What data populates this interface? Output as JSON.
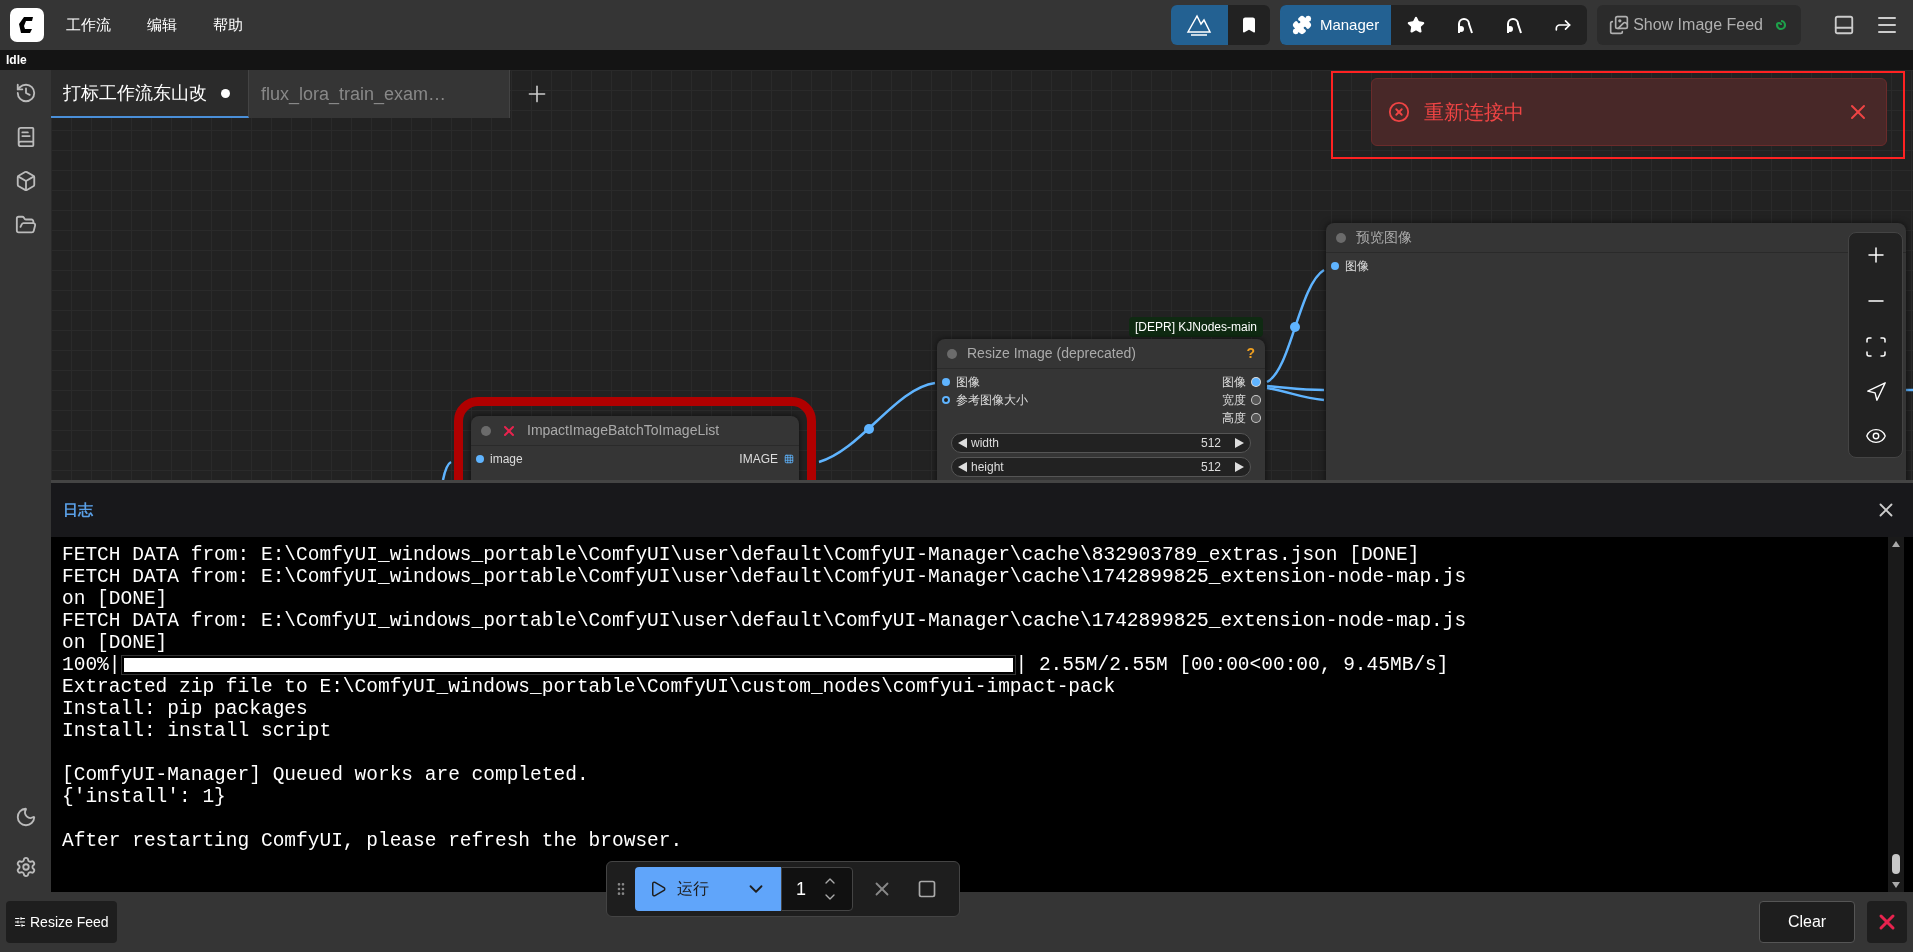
{
  "menu": [
    {
      "label": "工作流"
    },
    {
      "label": "编辑"
    },
    {
      "label": "帮助"
    }
  ],
  "status": "Idle",
  "toolbar": {
    "manager": "Manager",
    "image_feed": "Show Image Feed"
  },
  "tabs": [
    {
      "label": "打标工作流东山改",
      "selected": true,
      "modified": true
    },
    {
      "label": "flux_lora_train_exam…",
      "selected": false,
      "modified": false
    }
  ],
  "toast": {
    "message": "重新连接中"
  },
  "nodes": [
    {
      "title": "预览图像",
      "error": false,
      "inputs": [
        {
          "label": "图像",
          "optional": false
        }
      ]
    },
    {
      "title": "Resize Image (deprecated)",
      "badge": "[DEPR] KJNodes-main",
      "help": "?",
      "error": false,
      "inputs": [
        {
          "label": "图像",
          "optional": false
        },
        {
          "label": "参考图像大小",
          "optional": true
        }
      ],
      "outputs": [
        {
          "label": "图像",
          "connected": true,
          "list": false
        },
        {
          "label": "宽度",
          "connected": false,
          "list": false
        },
        {
          "label": "高度",
          "connected": false,
          "list": false
        }
      ],
      "widgets": [
        {
          "name": "width",
          "value": "512"
        },
        {
          "name": "height",
          "value": "512"
        }
      ]
    },
    {
      "title": "ImpactImageBatchToImageList",
      "error": true,
      "inputs": [
        {
          "label": "image",
          "optional": false
        }
      ],
      "outputs": [
        {
          "label": "IMAGE",
          "connected": true,
          "list": true
        }
      ]
    }
  ],
  "log": {
    "title": "日志",
    "lines": [
      {
        "kind": "text",
        "text": "FETCH DATA from: E:\\ComfyUI_windows_portable\\ComfyUI\\user\\default\\ComfyUI-Manager\\cache\\832903789_extras.json [DONE]"
      },
      {
        "kind": "text",
        "text": "FETCH DATA from: E:\\ComfyUI_windows_portable\\ComfyUI\\user\\default\\ComfyUI-Manager\\cache\\1742899825_extension-node-map.js"
      },
      {
        "kind": "text",
        "text": "on [DONE]"
      },
      {
        "kind": "text",
        "text": "FETCH DATA from: E:\\ComfyUI_windows_portable\\ComfyUI\\user\\default\\ComfyUI-Manager\\cache\\1742899825_extension-node-map.js"
      },
      {
        "kind": "text",
        "text": "on [DONE]"
      },
      {
        "kind": "progress",
        "text": "100%|",
        "level": 1,
        "suffix": "| 2.55M/2.55M [00:00<00:00, 9.45MB/s]"
      },
      {
        "kind": "text",
        "text": "Extracted zip file to E:\\ComfyUI_windows_portable\\ComfyUI\\custom_nodes\\comfyui-impact-pack"
      },
      {
        "kind": "text",
        "text": "Install: pip packages"
      },
      {
        "kind": "text",
        "text": "Install: install script"
      },
      {
        "kind": "text",
        "text": "[ComfyUI-Manager] Queued works are completed.",
        "space_before": true
      },
      {
        "kind": "text",
        "text": "{'install': 1}"
      },
      {
        "kind": "text",
        "text": "After restarting ComfyUI, please refresh the browser.",
        "space_before": true
      }
    ]
  },
  "run_bar": {
    "label": "运行",
    "count": "1"
  },
  "bottom": {
    "resize_feed": "Resize Feed",
    "clear": "Clear"
  }
}
